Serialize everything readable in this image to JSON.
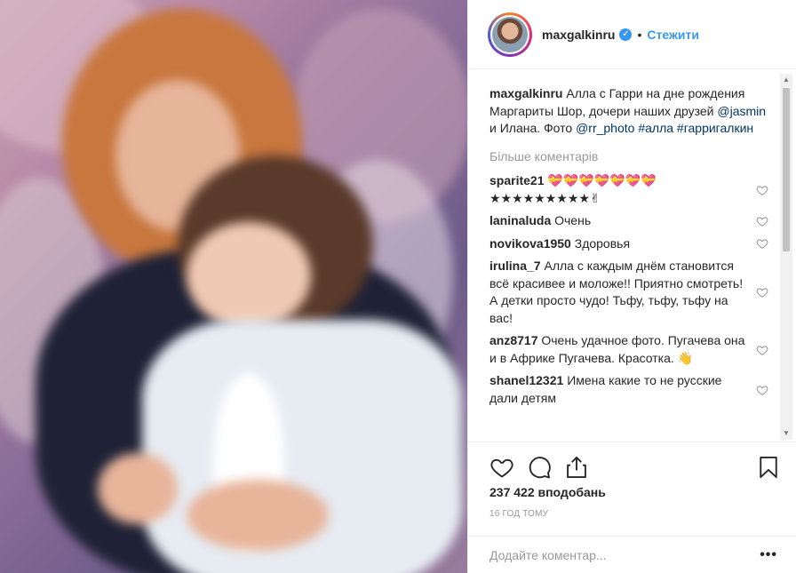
{
  "header": {
    "username": "maxgalkinru",
    "separator": "•",
    "follow_label": "Стежити"
  },
  "caption": {
    "username": "maxgalkinru",
    "text_1": "Алла с Гарри на дне рождения Маргариты Шор, дочери наших друзей ",
    "mention_1": "@jasmin",
    "text_2": " и Илана. Фото ",
    "mention_2": "@rr_photo",
    "hashtag_1": "#алла",
    "hashtag_2": "#гарригалкин"
  },
  "more_comments_label": "Більше коментарів",
  "comments": [
    {
      "user": "sparite21",
      "text": "💝💝💝💝💝💝💝★★★★★★★★★✌"
    },
    {
      "user": "laninaluda",
      "text": "Очень"
    },
    {
      "user": "novikova1950",
      "text": "Здоровья"
    },
    {
      "user": "irulina_7",
      "text": "Алла с каждым днём становится всё красивее и моложе!! Приятно смотреть! А детки просто чудо! Тьфу, тьфу, тьфу на вас!"
    },
    {
      "user": "anz8717",
      "text": "Очень удачное фото. Пугачева она и в Африке Пугачева. Красотка. 👋"
    },
    {
      "user": "shanel12321",
      "text": "Имена какие то не русские дали детям"
    }
  ],
  "likes": "237 422 вподобань",
  "time": "16 ГОД ТОМУ",
  "add_comment": {
    "placeholder": "Додайте коментар..."
  },
  "more_options": "•••",
  "icons": {
    "verified": "verified-badge-icon",
    "like": "heart-icon",
    "comment": "comment-icon",
    "share": "share-icon",
    "save": "bookmark-icon",
    "comment_like": "small-heart-icon"
  },
  "colors": {
    "accent": "#3897f0",
    "text": "#262626",
    "muted": "#999999",
    "link": "#003569"
  }
}
